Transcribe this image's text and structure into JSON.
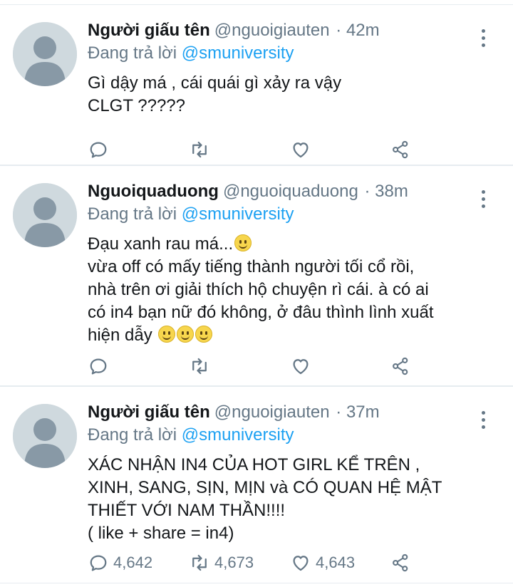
{
  "tweets": [
    {
      "name": "Người giấu tên",
      "handle": "@nguoigiauten",
      "time": "· 42m",
      "replying_prefix": "Đang trả lời",
      "replying_to": "@smuniversity",
      "lines": [
        "Gì dậy má , cái quái gì xảy ra vậy",
        "CLGT ?????"
      ],
      "reply_count": "",
      "retweet_count": "",
      "like_count": ""
    },
    {
      "name": "Nguoiquaduong",
      "handle": "@nguoiquaduong",
      "time": "· 38m",
      "replying_prefix": "Đang trả lời",
      "replying_to": "@smuniversity",
      "lines": [
        "Đạu xanh rau má...",
        "vừa off có mấy tiếng thành người tối cổ rồi,",
        "nhà trên ơi giải thích hộ chuyện rì cái. à có ai",
        "có in4 bạn nữ đó không, ở đâu thình lình xuất",
        "hiện dẫy"
      ],
      "reply_count": "",
      "retweet_count": "",
      "like_count": ""
    },
    {
      "name": "Người giấu tên",
      "handle": "@nguoigiauten",
      "time": "· 37m",
      "replying_prefix": "Đang trả lời",
      "replying_to": "@smuniversity",
      "lines": [
        "XÁC NHẬN IN4 CỦA HOT GIRL KỂ TRÊN  ,",
        "XINH, SANG, SỊN, MỊN và CÓ QUAN HỆ MẬT",
        "THIẾT VỚI NAM THẦN!!!!",
        "( like + share = in4)"
      ],
      "reply_count": "4,642",
      "retweet_count": "4,673",
      "like_count": "4,643"
    }
  ],
  "icons": {
    "avatar": "default-avatar-icon",
    "more": "more-vertical-icon",
    "reply": "reply-icon",
    "retweet": "retweet-icon",
    "like": "heart-icon",
    "share": "share-icon",
    "emoji": "slightly-smiling-face-emoji"
  },
  "colors": {
    "text": "#14171a",
    "secondary": "#657786",
    "accent": "#1da1f2",
    "divider": "#e6ecf0",
    "avatar_bg": "#cfd9de",
    "avatar_fg": "#8899a6"
  }
}
